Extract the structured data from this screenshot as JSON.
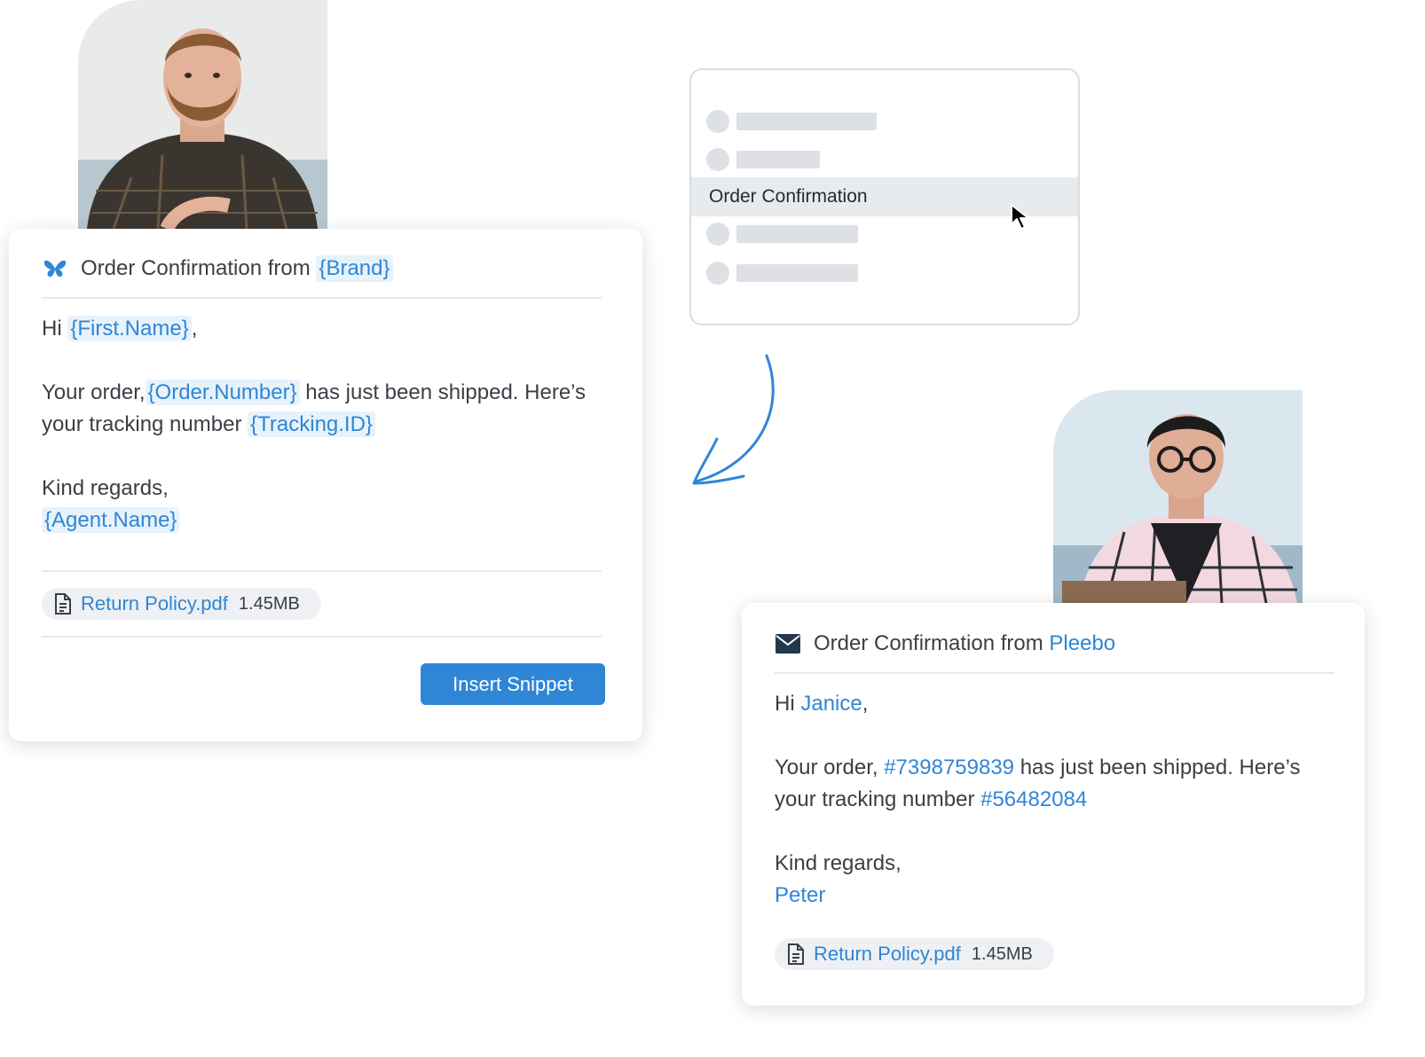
{
  "template_card": {
    "subject_prefix": "Order Confirmation from",
    "subject_token": "{Brand}",
    "greeting": "Hi",
    "first_name_token": "{First.Name}",
    "order_prefix": "Your order,",
    "order_token": "{Order.Number}",
    "order_suffix": "has just been shipped. Here’s",
    "tracking_prefix": "your tracking number",
    "tracking_token": "{Tracking.ID}",
    "closing": "Kind regards,",
    "agent_token": "{Agent.Name}",
    "attachment": {
      "name": "Return Policy.pdf",
      "size": "1.45MB"
    },
    "insert_button": "Insert Snippet",
    "icon": "butterfly-icon"
  },
  "snippet_menu": {
    "selected_item": "Order Confirmation",
    "placeholder_rows": 4,
    "cursor_icon": "mouse-pointer-icon"
  },
  "result_card": {
    "subject_prefix": "Order Confirmation from",
    "brand": "Pleebo",
    "greeting": "Hi",
    "first_name": "Janice",
    "order_prefix": "Your order,",
    "order_number": "#7398759839",
    "order_suffix": "has just been shipped. Here’s",
    "tracking_prefix": "your tracking number",
    "tracking_id": "#56482084",
    "closing": "Kind regards,",
    "agent_name": "Peter",
    "attachment": {
      "name": "Return Policy.pdf",
      "size": "1.45MB"
    },
    "icon": "envelope-icon"
  },
  "colors": {
    "accent": "#2f86d6",
    "token_bg": "#e8f2fb",
    "text": "#3a3f45",
    "placeholder": "#dde1e6"
  }
}
